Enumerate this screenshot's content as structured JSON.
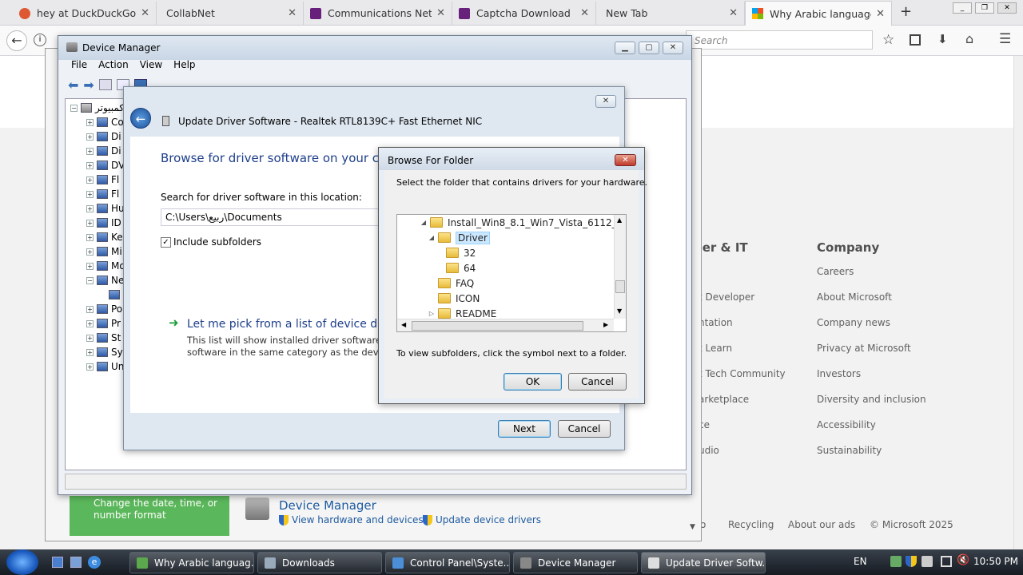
{
  "browser": {
    "tabs": [
      {
        "title": "hey at DuckDuckGo",
        "icon": "duckduckgo-icon"
      },
      {
        "title": "CollabNet",
        "icon": ""
      },
      {
        "title": "Communications Netw",
        "icon": "vs-icon"
      },
      {
        "title": "Captcha Download",
        "icon": "vs-icon"
      },
      {
        "title": "New Tab",
        "icon": ""
      },
      {
        "title": "Why Arabic language is",
        "icon": "microsoft-icon"
      }
    ],
    "new_tab_label": "+",
    "search_placeholder": "Search",
    "window_controls": [
      "_",
      "❐",
      "✕"
    ]
  },
  "webpage": {
    "columns": [
      {
        "heading": "per & IT",
        "links": [
          "t Developer",
          "ntation",
          "t Learn",
          "t Tech Community",
          "arketplace",
          "ce",
          "udio"
        ]
      },
      {
        "heading": "Company",
        "links": [
          "Careers",
          "About Microsoft",
          "Company news",
          "Privacy at Microsoft",
          "Investors",
          "Diversity and inclusion",
          "Accessibility",
          "Sustainability"
        ]
      }
    ],
    "bottom_links": [
      "o",
      "Recycling",
      "About our ads",
      "© Microsoft 2025"
    ]
  },
  "control_panel": {
    "side_text": "Change the date, time, or number format",
    "title": "Device Manager",
    "link1": "View hardware and devices",
    "link2": "Update device drivers"
  },
  "device_manager": {
    "title": "Device Manager",
    "menu": [
      "File",
      "Action",
      "View",
      "Help"
    ],
    "root_label": "كمبيوتر",
    "tree": [
      "Co",
      "Di",
      "Di",
      "DV",
      "Fl",
      "Fl",
      "Hu",
      "ID",
      "Ke",
      "Mi",
      "Mo",
      "Ne",
      "",
      "Po",
      "Pr",
      "St",
      "Sy",
      "Un"
    ]
  },
  "update_driver": {
    "title": "Update Driver Software - Realtek RTL8139C+ Fast Ethernet NIC",
    "heading": "Browse for driver software on your com",
    "search_label": "Search for driver software in this location:",
    "path_value": "C:\\Users\\ربيع\\Documents",
    "include_subfolders": "Include subfolders",
    "pick_heading": "Let me pick from a list of device dri",
    "pick_desc_line1": "This list will show installed driver software co",
    "pick_desc_line2": "software in the same category as the device.",
    "next": "Next",
    "cancel": "Cancel"
  },
  "browse_folder": {
    "title": "Browse For Folder",
    "instruction": "Select the folder that contains drivers for your hardware.",
    "folders": [
      {
        "label": "Install_Win8_8.1_Win7_Vista_6112_03122",
        "indent": 0,
        "expander": "open"
      },
      {
        "label": "Driver",
        "indent": 1,
        "expander": "open",
        "selected": true
      },
      {
        "label": "32",
        "indent": 2,
        "expander": "none"
      },
      {
        "label": "64",
        "indent": 2,
        "expander": "none"
      },
      {
        "label": "FAQ",
        "indent": 1,
        "expander": "none"
      },
      {
        "label": "ICON",
        "indent": 1,
        "expander": "none"
      },
      {
        "label": "README",
        "indent": 1,
        "expander": "closed"
      }
    ],
    "hint": "To view subfolders, click the symbol next to a folder.",
    "ok": "OK",
    "cancel": "Cancel"
  },
  "taskbar": {
    "items": [
      "Why Arabic languag...",
      "Downloads",
      "Control Panel\\Syste...",
      "Device Manager",
      "Update Driver Softw..."
    ],
    "lang": "EN",
    "time": "10:50 PM"
  }
}
